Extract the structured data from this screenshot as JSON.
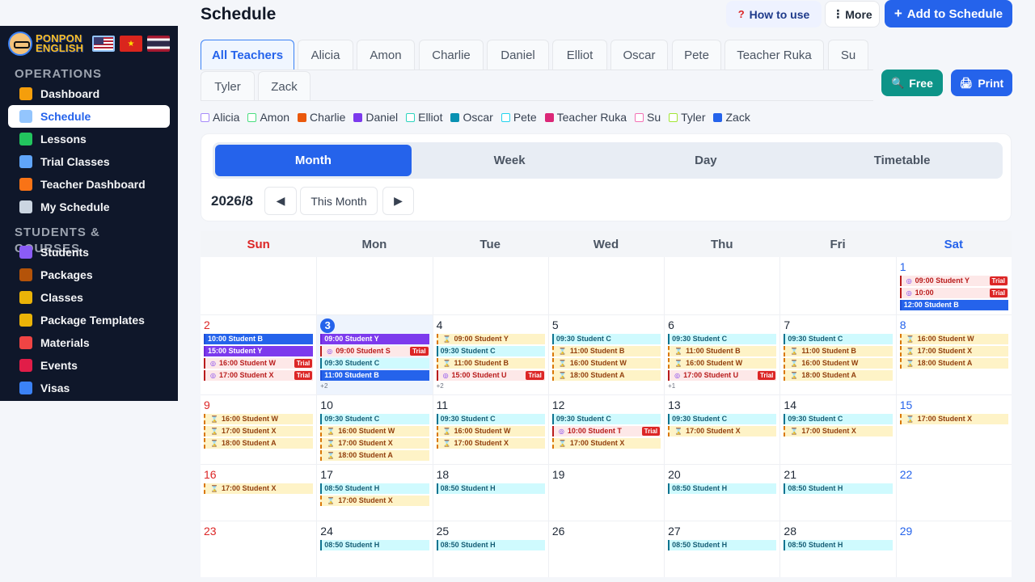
{
  "app": {
    "brand_line1": "PONPON",
    "brand_line2": "ENGLISH",
    "flags": [
      {
        "name": "us-flag",
        "glyph": ""
      },
      {
        "name": "vietnam-flag",
        "glyph": "★"
      },
      {
        "name": "thailand-flag",
        "glyph": ""
      }
    ]
  },
  "sidebar": {
    "sections": [
      {
        "title": "OPERATIONS",
        "items": [
          {
            "label": "Dashboard",
            "icon": "house-icon",
            "color": "#f59e0b",
            "active": false
          },
          {
            "label": "Schedule",
            "icon": "calendar-icon",
            "color": "#93c5fd",
            "active": true
          },
          {
            "label": "Lessons",
            "icon": "checkbox-icon",
            "color": "#22c55e",
            "active": false
          },
          {
            "label": "Trial Classes",
            "icon": "magnifier-icon",
            "color": "#60a5fa",
            "active": false
          },
          {
            "label": "Teacher Dashboard",
            "icon": "teacher-icon",
            "color": "#f97316",
            "active": false
          },
          {
            "label": "My Schedule",
            "icon": "calendar-icon",
            "color": "#cbd5e1",
            "active": false
          }
        ]
      },
      {
        "title": "STUDENTS & COURSES",
        "items": [
          {
            "label": "Students",
            "icon": "students-icon",
            "color": "#8b5cf6",
            "active": false
          },
          {
            "label": "Packages",
            "icon": "package-icon",
            "color": "#b45309",
            "active": false
          },
          {
            "label": "Classes",
            "icon": "people-icon",
            "color": "#eab308",
            "active": false
          },
          {
            "label": "Package Templates",
            "icon": "folder-icon",
            "color": "#eab308",
            "active": false
          },
          {
            "label": "Materials",
            "icon": "books-icon",
            "color": "#ef4444",
            "active": false
          },
          {
            "label": "Events",
            "icon": "ticket-icon",
            "color": "#e11d48",
            "active": false
          },
          {
            "label": "Visas",
            "icon": "passport-icon",
            "color": "#3b82f6",
            "active": false
          }
        ]
      }
    ]
  },
  "header": {
    "title": "Schedule",
    "help_label": "How to use",
    "help_icon": "?",
    "more_label": "More",
    "more_icon": "⋮",
    "add_label": "Add to Schedule",
    "add_icon": "+",
    "free_label": "Free",
    "free_icon": "🔍",
    "print_label": "Print",
    "print_icon": "🖨"
  },
  "tabs": [
    {
      "label": "All Teachers",
      "active": true
    },
    {
      "label": "Alicia"
    },
    {
      "label": "Amon"
    },
    {
      "label": "Charlie"
    },
    {
      "label": "Daniel"
    },
    {
      "label": "Elliot"
    },
    {
      "label": "Oscar"
    },
    {
      "label": "Pete"
    },
    {
      "label": "Teacher Ruka"
    },
    {
      "label": "Su"
    },
    {
      "label": "Tyler"
    },
    {
      "label": "Zack"
    }
  ],
  "legend": [
    {
      "label": "Alicia",
      "color": "#a78bfa",
      "filled": false
    },
    {
      "label": "Amon",
      "color": "#4ade80",
      "filled": false
    },
    {
      "label": "Charlie",
      "color": "#ea580c",
      "filled": true
    },
    {
      "label": "Daniel",
      "color": "#7c3aed",
      "filled": true
    },
    {
      "label": "Elliot",
      "color": "#2dd4bf",
      "filled": false
    },
    {
      "label": "Oscar",
      "color": "#0891b2",
      "filled": true
    },
    {
      "label": "Pete",
      "color": "#22d3ee",
      "filled": false
    },
    {
      "label": "Teacher Ruka",
      "color": "#db2777",
      "filled": true
    },
    {
      "label": "Su",
      "color": "#f472b6",
      "filled": false
    },
    {
      "label": "Tyler",
      "color": "#a3e635",
      "filled": false
    },
    {
      "label": "Zack",
      "color": "#2563eb",
      "filled": true
    }
  ],
  "views": [
    {
      "label": "Month",
      "active": true
    },
    {
      "label": "Week"
    },
    {
      "label": "Day"
    },
    {
      "label": "Timetable"
    }
  ],
  "calendar": {
    "month_label": "2026/8",
    "prev_icon": "◀",
    "next_icon": "▶",
    "this_month_label": "This Month",
    "weekdays": [
      "Sun",
      "Mon",
      "Tue",
      "Wed",
      "Thu",
      "Fri",
      "Sat"
    ],
    "trial_label": "Trial",
    "weeks": [
      [
        {
          "day": "",
          "events": []
        },
        {
          "day": "",
          "events": []
        },
        {
          "day": "",
          "events": []
        },
        {
          "day": "",
          "events": []
        },
        {
          "day": "",
          "events": []
        },
        {
          "day": "",
          "events": []
        },
        {
          "day": "1",
          "events": [
            {
              "text": "09:00 Student Y",
              "kind": "trial"
            },
            {
              "text": "10:00",
              "kind": "trial"
            },
            {
              "text": "12:00 Student B",
              "kind": "blue"
            }
          ]
        }
      ],
      [
        {
          "day": "2",
          "events": [
            {
              "text": "10:00 Student B",
              "kind": "blue"
            },
            {
              "text": "15:00 Student Y",
              "kind": "purple"
            },
            {
              "text": "16:00 Student W",
              "kind": "trial"
            },
            {
              "text": "17:00 Student X",
              "kind": "trial"
            }
          ]
        },
        {
          "day": "3",
          "today": true,
          "events": [
            {
              "text": "09:00 Student Y",
              "kind": "purple"
            },
            {
              "text": "09:00 Student S",
              "kind": "trial"
            },
            {
              "text": "09:30 Student C",
              "kind": "cyan"
            },
            {
              "text": "11:00 Student B",
              "kind": "blue"
            }
          ],
          "more": "+2"
        },
        {
          "day": "4",
          "events": [
            {
              "text": "09:00 Student Y",
              "kind": "hourglass"
            },
            {
              "text": "09:30 Student C",
              "kind": "cyan"
            },
            {
              "text": "11:00 Student B",
              "kind": "hourglass"
            },
            {
              "text": "15:00 Student U",
              "kind": "trial"
            }
          ],
          "more": "+2"
        },
        {
          "day": "5",
          "events": [
            {
              "text": "09:30 Student C",
              "kind": "cyan"
            },
            {
              "text": "11:00 Student B",
              "kind": "hourglass"
            },
            {
              "text": "16:00 Student W",
              "kind": "hourglass"
            },
            {
              "text": "18:00 Student A",
              "kind": "hourglass"
            }
          ]
        },
        {
          "day": "6",
          "events": [
            {
              "text": "09:30 Student C",
              "kind": "cyan"
            },
            {
              "text": "11:00 Student B",
              "kind": "hourglass"
            },
            {
              "text": "16:00 Student W",
              "kind": "hourglass"
            },
            {
              "text": "17:00 Student U",
              "kind": "trial"
            }
          ],
          "more": "+1"
        },
        {
          "day": "7",
          "events": [
            {
              "text": "09:30 Student C",
              "kind": "cyan"
            },
            {
              "text": "11:00 Student B",
              "kind": "hourglass"
            },
            {
              "text": "16:00 Student W",
              "kind": "hourglass"
            },
            {
              "text": "18:00 Student A",
              "kind": "hourglass"
            }
          ]
        },
        {
          "day": "8",
          "events": [
            {
              "text": "16:00 Student W",
              "kind": "hourglass"
            },
            {
              "text": "17:00 Student X",
              "kind": "hourglass"
            },
            {
              "text": "18:00 Student A",
              "kind": "hourglass"
            }
          ]
        }
      ],
      [
        {
          "day": "9",
          "events": [
            {
              "text": "16:00 Student W",
              "kind": "hourglass"
            },
            {
              "text": "17:00 Student X",
              "kind": "hourglass"
            },
            {
              "text": "18:00 Student A",
              "kind": "hourglass"
            }
          ]
        },
        {
          "day": "10",
          "events": [
            {
              "text": "09:30 Student C",
              "kind": "cyan"
            },
            {
              "text": "16:00 Student W",
              "kind": "hourglass"
            },
            {
              "text": "17:00 Student X",
              "kind": "hourglass"
            },
            {
              "text": "18:00 Student A",
              "kind": "hourglass"
            }
          ]
        },
        {
          "day": "11",
          "events": [
            {
              "text": "09:30 Student C",
              "kind": "cyan"
            },
            {
              "text": "16:00 Student W",
              "kind": "hourglass"
            },
            {
              "text": "17:00 Student X",
              "kind": "hourglass"
            }
          ]
        },
        {
          "day": "12",
          "events": [
            {
              "text": "09:30 Student C",
              "kind": "cyan"
            },
            {
              "text": "10:00 Student T",
              "kind": "trial"
            },
            {
              "text": "17:00 Student X",
              "kind": "hourglass"
            }
          ]
        },
        {
          "day": "13",
          "events": [
            {
              "text": "09:30 Student C",
              "kind": "cyan"
            },
            {
              "text": "17:00 Student X",
              "kind": "hourglass"
            }
          ]
        },
        {
          "day": "14",
          "events": [
            {
              "text": "09:30 Student C",
              "kind": "cyan"
            },
            {
              "text": "17:00 Student X",
              "kind": "hourglass"
            }
          ]
        },
        {
          "day": "15",
          "events": [
            {
              "text": "17:00 Student X",
              "kind": "hourglass"
            }
          ]
        }
      ],
      [
        {
          "day": "16",
          "events": [
            {
              "text": "17:00 Student X",
              "kind": "hourglass"
            }
          ]
        },
        {
          "day": "17",
          "events": [
            {
              "text": "08:50 Student H",
              "kind": "cyan"
            },
            {
              "text": "17:00 Student X",
              "kind": "hourglass"
            }
          ]
        },
        {
          "day": "18",
          "events": [
            {
              "text": "08:50 Student H",
              "kind": "cyan"
            }
          ]
        },
        {
          "day": "19",
          "events": []
        },
        {
          "day": "20",
          "events": [
            {
              "text": "08:50 Student H",
              "kind": "cyan"
            }
          ]
        },
        {
          "day": "21",
          "events": [
            {
              "text": "08:50 Student H",
              "kind": "cyan"
            }
          ]
        },
        {
          "day": "22",
          "events": []
        }
      ],
      [
        {
          "day": "23",
          "events": []
        },
        {
          "day": "24",
          "events": [
            {
              "text": "08:50 Student H",
              "kind": "cyan"
            }
          ]
        },
        {
          "day": "25",
          "events": [
            {
              "text": "08:50 Student H",
              "kind": "cyan"
            }
          ]
        },
        {
          "day": "26",
          "events": []
        },
        {
          "day": "27",
          "events": [
            {
              "text": "08:50 Student H",
              "kind": "cyan"
            }
          ]
        },
        {
          "day": "28",
          "events": [
            {
              "text": "08:50 Student H",
              "kind": "cyan"
            }
          ]
        },
        {
          "day": "29",
          "events": []
        }
      ]
    ]
  },
  "colors": {
    "accent": "#2563eb",
    "teal": "#0d9488",
    "sidebar_bg": "#0f172a",
    "trial_red": "#dc2626",
    "hourglass_bg": "#fef3c7",
    "cyan_bg": "#cffafe"
  }
}
